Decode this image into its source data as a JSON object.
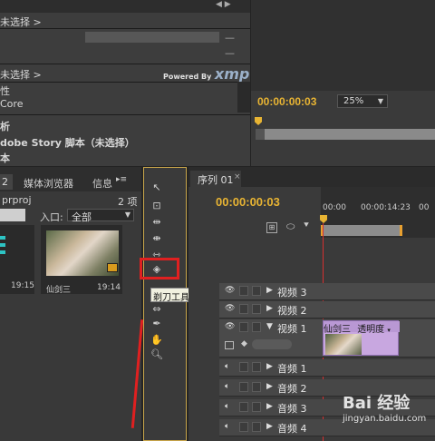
{
  "metadata_panel": {
    "rows": [
      "未选择 >",
      "未选择 >",
      "性",
      "Core",
      "析",
      "dobe Story 脚本（未选择）",
      "本"
    ],
    "powered_by": "Powered By",
    "xmp_logo": "xmp"
  },
  "program_monitor": {
    "timecode": "00:00:00:03",
    "zoom": "25%"
  },
  "project_panel": {
    "tabs": [
      "2",
      "媒体浏览器",
      "信息"
    ],
    "project_file": "prproj",
    "item_count": "2 项",
    "in_label": "入口:",
    "in_value": "全部",
    "clips": [
      {
        "duration": "19:15"
      },
      {
        "name": "仙剑三",
        "duration": "19:14"
      }
    ]
  },
  "tools_panel": {
    "tooltip": "剃刀工具 (C)"
  },
  "timeline": {
    "tab_label": "序列 01",
    "timecode": "00:00:00:03",
    "ruler": [
      "00:00",
      "00:00:14:23",
      "00"
    ],
    "tracks": [
      {
        "name": "视频 3",
        "kind": "video"
      },
      {
        "name": "视频 2",
        "kind": "video"
      },
      {
        "name": "视频 1",
        "kind": "video"
      },
      {
        "name": "音频 1",
        "kind": "audio"
      },
      {
        "name": "音频 2",
        "kind": "audio"
      },
      {
        "name": "音频 3",
        "kind": "audio"
      },
      {
        "name": "音频 4",
        "kind": "audio"
      }
    ],
    "clip_label": "仙剑三",
    "clip_effect": "透明度"
  },
  "watermark": {
    "brand": "Bai 经验",
    "url": "jingyan.baidu.com"
  },
  "colors": {
    "timecode": "#e8b433",
    "highlight_red": "#e02020",
    "clip_purple": "#c8a7e0"
  }
}
